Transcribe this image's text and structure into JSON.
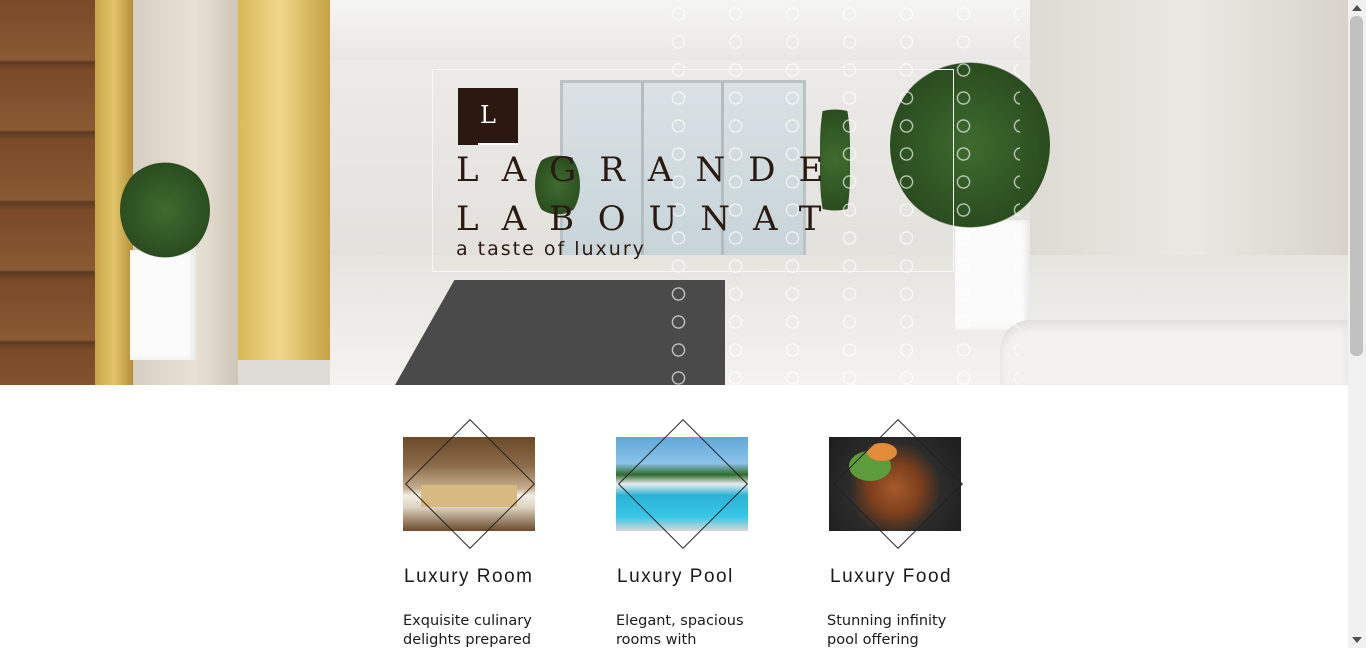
{
  "hero": {
    "logo_letter": "L",
    "brand_line1": "LAGRANDE",
    "brand_line2": "LABOUNAT",
    "tagline": "a taste of luxury"
  },
  "features": [
    {
      "title": "Luxury Room",
      "description": "Exquisite culinary delights prepared",
      "image": "hotel-bedroom-photo"
    },
    {
      "title": "Luxury Pool",
      "description": "Elegant, spacious rooms with",
      "image": "infinity-pool-photo"
    },
    {
      "title": "Luxury Food",
      "description": "Stunning infinity pool offering",
      "image": "gourmet-dish-photo"
    }
  ],
  "colors": {
    "brand_dark": "#2b1810",
    "text": "#1a1a1a",
    "frame": "#f7f7f7"
  }
}
